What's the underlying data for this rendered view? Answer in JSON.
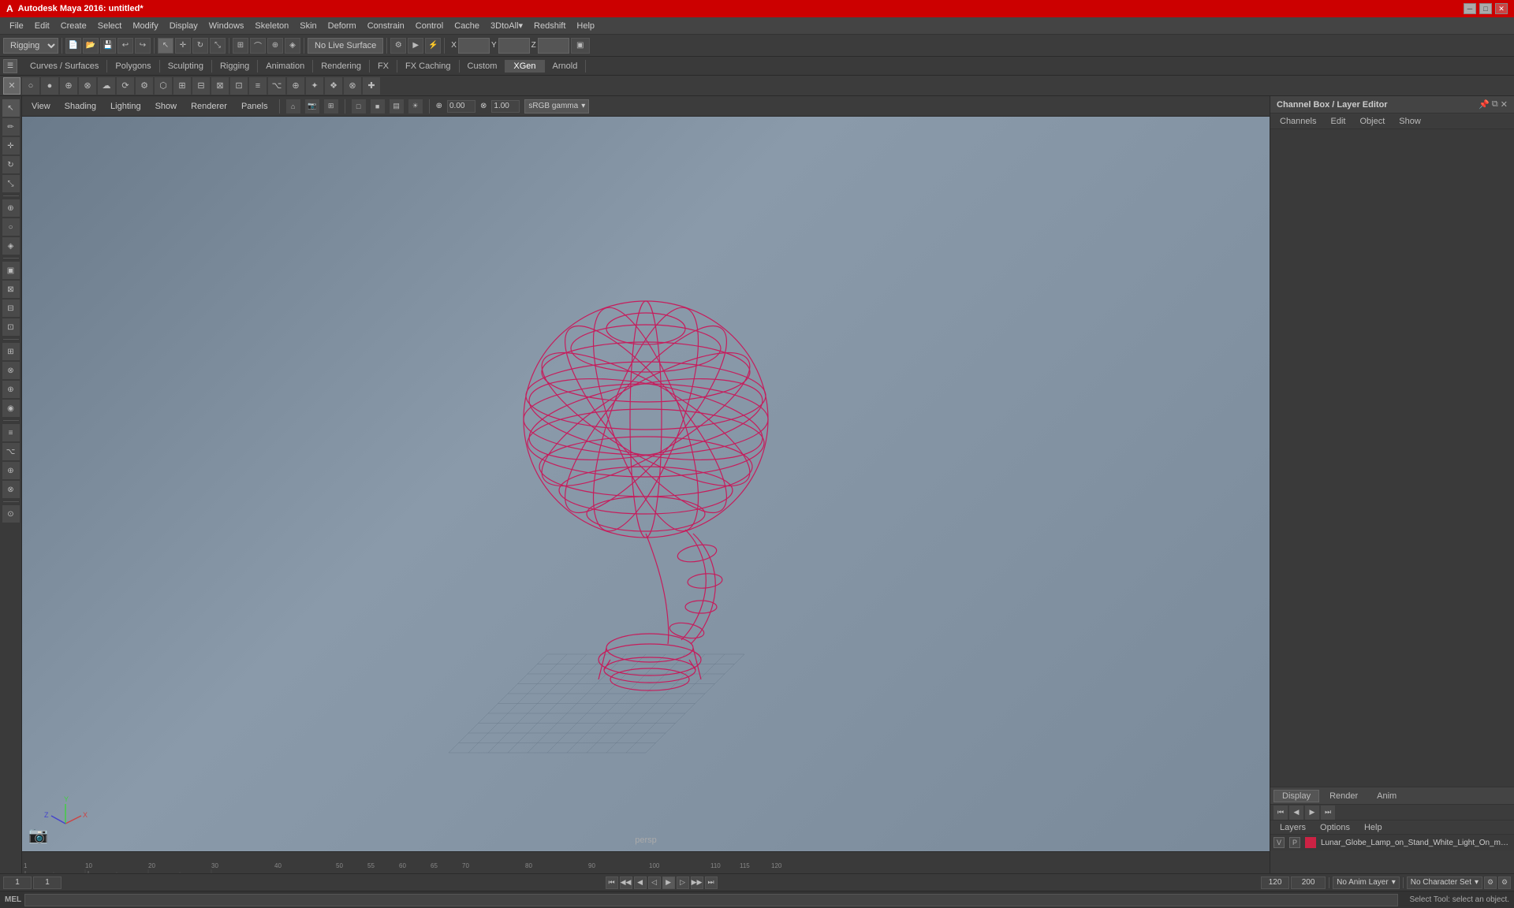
{
  "title_bar": {
    "title": "Autodesk Maya 2016: untitled*",
    "min_label": "─",
    "max_label": "□",
    "close_label": "✕"
  },
  "menu_bar": {
    "items": [
      "File",
      "Edit",
      "Create",
      "Select",
      "Modify",
      "Display",
      "Windows",
      "Skeleton",
      "Skin",
      "Deform",
      "Constrain",
      "Control",
      "Cache",
      "3DtoAll▾",
      "Redshift",
      "Help"
    ]
  },
  "toolbar1": {
    "mode_dropdown": "Rigging",
    "no_live_surface": "No Live Surface",
    "x_field": "",
    "y_field": "",
    "z_field": ""
  },
  "module_bar": {
    "tabs": [
      "Curves / Surfaces",
      "Polygons",
      "Sculpting",
      "Rigging",
      "Animation",
      "Rendering",
      "FX",
      "FX Caching",
      "Custom",
      "XGen",
      "Arnold"
    ]
  },
  "viewport_header": {
    "menus": [
      "View",
      "Shading",
      "Lighting",
      "Show",
      "Renderer",
      "Panels"
    ],
    "gamma": "sRGB gamma",
    "val1": "0.00",
    "val2": "1.00"
  },
  "viewport": {
    "label": "persp"
  },
  "channel_box": {
    "title": "Channel Box / Layer Editor",
    "tabs": [
      "Channels",
      "Edit",
      "Object",
      "Show"
    ],
    "layer_tabs": [
      "Display",
      "Render",
      "Anim"
    ],
    "layers_header_tabs": [
      "Layers",
      "Options",
      "Help"
    ],
    "layer_items": [
      {
        "vp": "V",
        "p": "P",
        "color": "#cc2244",
        "name": "Lunar_Globe_Lamp_on_Stand_White_Light_On_mb_stan"
      }
    ]
  },
  "playback": {
    "start": "1",
    "current": "1",
    "end": "120",
    "range_end": "200",
    "anim_layer": "No Anim Layer",
    "char_set": "No Character Set"
  },
  "timeline": {
    "marks": [
      "1",
      "",
      "",
      "",
      "",
      "10",
      "",
      "",
      "",
      "",
      "20",
      "",
      "",
      "",
      "",
      "30",
      "",
      "",
      "",
      "",
      "40",
      "",
      "",
      "",
      "",
      "50",
      "",
      "",
      "",
      "",
      "55",
      "",
      "",
      "",
      "",
      "60",
      "",
      "",
      "",
      "",
      "65",
      "",
      "",
      "",
      "",
      "70",
      "",
      "",
      "",
      "",
      "80",
      "",
      "",
      "",
      "",
      "90",
      "",
      "",
      "",
      "",
      "100",
      "",
      "",
      "",
      "",
      "110",
      "",
      "",
      "",
      "",
      "115",
      "",
      "",
      "",
      "",
      "120"
    ]
  },
  "mel": {
    "label": "MEL",
    "placeholder": "",
    "status": "Select Tool: select an object."
  },
  "left_toolbar": {
    "tools": [
      "↖",
      "↔",
      "↕",
      "↻",
      "⊕",
      "✏",
      "⬡",
      "◈",
      "▣",
      "◉",
      "⊞",
      "⊠",
      "⊟",
      "⊡",
      "⊕",
      "⊗"
    ]
  }
}
